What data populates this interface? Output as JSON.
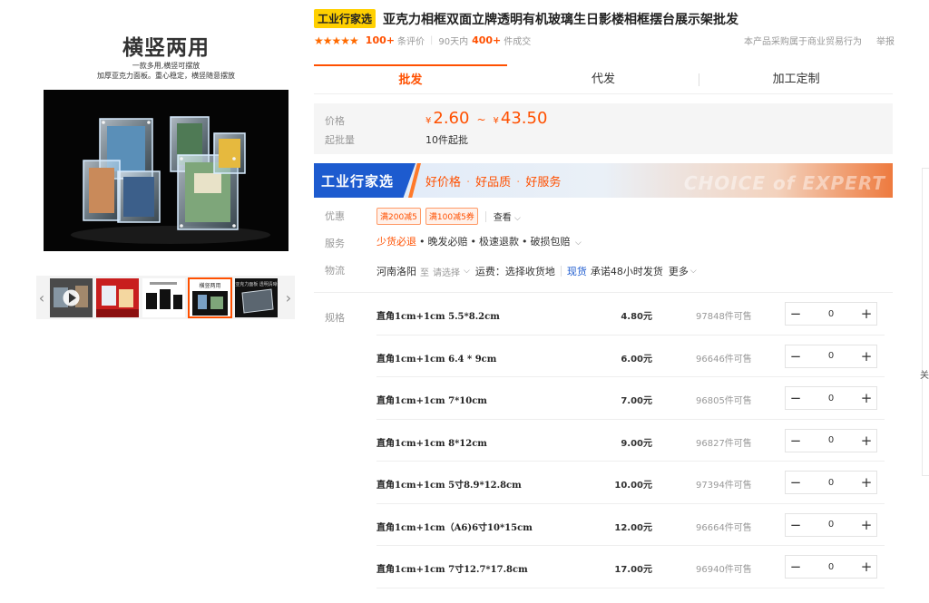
{
  "gallery": {
    "hero_title": "横竖两用",
    "hero_sub1": "一款多用,横竖可摆放",
    "hero_sub2": "加厚亚克力面板。重心稳定，横竖随意摆放",
    "thumb_prev": "‹",
    "thumb_next": "›",
    "thumb_labels": [
      "",
      "",
      "",
      "横竖两用",
      "亚克力面板 透明清晰"
    ],
    "active_thumb_index": 3
  },
  "product": {
    "badge": "工业行家选",
    "title": "亚克力相框双面立牌透明有机玻璃生日影楼相框摆台展示架批发",
    "stars": "★★★★★",
    "review_count": "100+",
    "review_label": "条评价",
    "sales_period": "90天内",
    "sales_count": "400+",
    "sales_label": "件成交",
    "trade_note": "本产品采购属于商业贸易行为",
    "report_link": "举报"
  },
  "tabs": [
    {
      "label": "批发",
      "active": true
    },
    {
      "label": "代发",
      "active": false
    },
    {
      "label": "加工定制",
      "active": false
    }
  ],
  "pricing": {
    "price_label": "价格",
    "currency": "¥",
    "price_min": "2.60",
    "tilde": "~",
    "price_max": "43.50",
    "min_order_label": "起批量",
    "min_order_value": "10件起批"
  },
  "expert_banner": {
    "title": "工业行家选",
    "tag1": "好价格",
    "tag2": "好品质",
    "tag3": "好服务",
    "dot": "·",
    "watermark": "CHOICE of EXPERT"
  },
  "promotions": {
    "label": "优惠",
    "coupons": [
      "满200减5",
      "满100减5券"
    ],
    "view_label": "查看",
    "chevron": "⌵"
  },
  "service": {
    "label": "服务",
    "items": [
      "少货必退",
      "晚发必赔",
      "极速退款",
      "破损包赔"
    ],
    "dot": "•"
  },
  "logistics": {
    "label": "物流",
    "origin": "河南洛阳",
    "to": "至",
    "select": "请选择",
    "freight": "运费：选择收货地",
    "in_stock": "现货",
    "promise": "承诺48小时发货",
    "more": "更多"
  },
  "specs": {
    "label": "规格",
    "minus": "−",
    "plus": "+",
    "rows": [
      {
        "name": "直角1cm+1cm 5.5*8.2cm",
        "price": "4.80元",
        "stock": "97848件可售",
        "qty": "0"
      },
      {
        "name": "直角1cm+1cm 6.4 * 9cm",
        "price": "6.00元",
        "stock": "96646件可售",
        "qty": "0"
      },
      {
        "name": "直角1cm+1cm 7*10cm",
        "price": "7.00元",
        "stock": "96805件可售",
        "qty": "0"
      },
      {
        "name": "直角1cm+1cm 8*12cm",
        "price": "9.00元",
        "stock": "96827件可售",
        "qty": "0"
      },
      {
        "name": "直角1cm+1cm 5寸8.9*12.8cm",
        "price": "10.00元",
        "stock": "97394件可售",
        "qty": "0"
      },
      {
        "name": "直角1cm+1cm（A6)6寸10*15cm",
        "price": "12.00元",
        "stock": "96664件可售",
        "qty": "0"
      },
      {
        "name": "直角1cm+1cm 7寸12.7*17.8cm",
        "price": "17.00元",
        "stock": "96940件可售",
        "qty": "0"
      }
    ]
  },
  "side": {
    "char": "关"
  },
  "colors": {
    "accent": "#ff5000",
    "badge": "#ffd000",
    "expert_blue": "#1d5bcf"
  }
}
